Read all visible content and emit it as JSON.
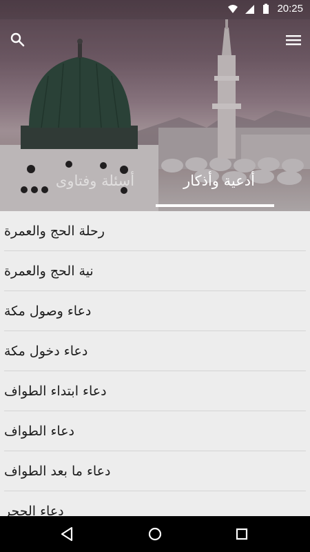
{
  "status_bar": {
    "time": "20:25"
  },
  "toolbar": {
    "search_icon": "search-icon",
    "menu_icon": "menu-icon"
  },
  "tabs": [
    {
      "label": "أدعية وأذكار",
      "active": true
    },
    {
      "label": "أسئلة وفتاوى",
      "active": false
    }
  ],
  "list": {
    "items": [
      "رحلة الحج والعمرة",
      "نية الحج والعمرة",
      "دعاء وصول مكة",
      "دعاء دخول مكة",
      "دعاء ابتداء الطواف",
      "دعاء الطواف",
      "دعاء ما بعد الطواف",
      "دعاء الحجر"
    ]
  },
  "nav_bar": {
    "back_icon": "back-icon",
    "home_icon": "home-icon",
    "recents_icon": "recents-icon"
  },
  "colors": {
    "accent": "#ffffff",
    "list_bg": "#ededed",
    "divider": "#d4d4d4",
    "nav_bg": "#000000"
  }
}
